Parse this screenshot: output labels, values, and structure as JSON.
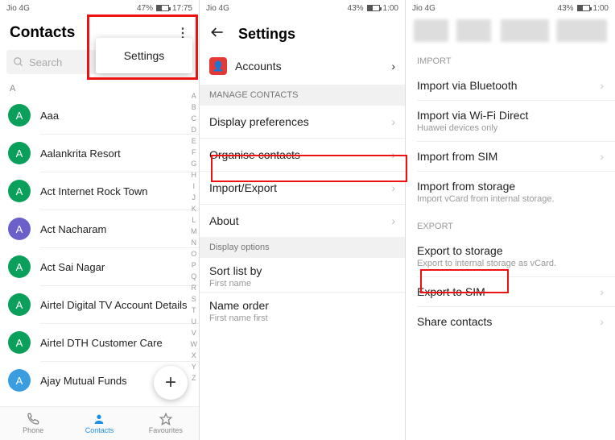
{
  "status": {
    "carrier": "Jio 4G",
    "signal": "📶",
    "battery_text": "43%",
    "time": "1:00",
    "time1": "17:75"
  },
  "p1": {
    "title": "Contacts",
    "search_placeholder": "Search",
    "menu_settings": "Settings",
    "section_a": "A",
    "contacts": [
      {
        "letter": "A",
        "name": "Aaa",
        "avatar": "g"
      },
      {
        "letter": "A",
        "name": "Aalankrita Resort",
        "avatar": "g"
      },
      {
        "letter": "A",
        "name": "Act Internet Rock Town",
        "avatar": "g"
      },
      {
        "letter": "A",
        "name": "Act Nacharam",
        "avatar": "p"
      },
      {
        "letter": "A",
        "name": "Act Sai Nagar",
        "avatar": "g"
      },
      {
        "letter": "A",
        "name": "Airtel Digital TV Account Details",
        "avatar": "g"
      },
      {
        "letter": "A",
        "name": "Airtel DTH Customer Care",
        "avatar": "g"
      },
      {
        "letter": "A",
        "name": "Ajay Mutual Funds",
        "avatar": "b"
      }
    ],
    "index": [
      "A",
      "B",
      "C",
      "D",
      "E",
      "F",
      "G",
      "H",
      "I",
      "J",
      "K",
      "L",
      "M",
      "N",
      "O",
      "P",
      "Q",
      "R",
      "S",
      "T",
      "U",
      "V",
      "W",
      "X",
      "Y",
      "Z"
    ],
    "bottom": {
      "phone": "Phone",
      "contacts": "Contacts",
      "fav": "Favourites"
    }
  },
  "p2": {
    "title": "Settings",
    "accounts": "Accounts",
    "grp_manage": "MANAGE CONTACTS",
    "display_pref": "Display preferences",
    "organise": "Organise contacts",
    "impexp": "Import/Export",
    "about": "About",
    "grp_display": "Display options",
    "sort_label": "Sort list by",
    "sort_value": "First name",
    "order_label": "Name order",
    "order_value": "First name first"
  },
  "p3": {
    "sect_import": "IMPORT",
    "imp_bt": "Import via Bluetooth",
    "imp_wifi": "Import via Wi-Fi Direct",
    "imp_wifi_sub": "Huawei devices only",
    "imp_sim": "Import from SIM",
    "imp_storage": "Import from storage",
    "imp_storage_sub": "Import vCard from internal storage.",
    "sect_export": "EXPORT",
    "exp_storage": "Export to storage",
    "exp_storage_sub": "Export to internal storage as vCard.",
    "exp_sim": "Export to SIM",
    "share": "Share contacts"
  }
}
